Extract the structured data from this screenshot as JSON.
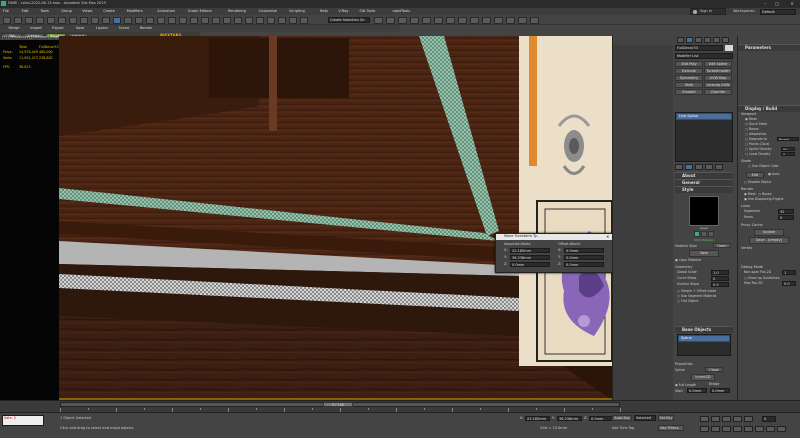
{
  "titlebar": {
    "title": "FAME - coins-2022-06-13.max - Autodesk 3ds Max 2019",
    "signin": "Sign In",
    "workspaces": "Workspaces:",
    "workspace_value": "Default"
  },
  "menu": [
    "File",
    "Edit",
    "Tools",
    "Group",
    "Views",
    "Create",
    "Modifiers",
    "Animation",
    "Graph Editors",
    "Rendering",
    "Customize",
    "Scripting",
    "Help",
    "V-Ray",
    "Silk Tools",
    "rapidTools"
  ],
  "toolbar": {
    "selection_set": "Create Selection Se",
    "row2": [
      "Merge",
      "Import",
      "Export",
      "Save",
      "Layers",
      "Scene",
      "Render"
    ]
  },
  "row3": {
    "tabs": [
      "Tab",
      "Layers",
      "Render",
      "Layout"
    ],
    "logo": "MAXTABS"
  },
  "viewport": {
    "label": "[+] [Perspective] [Standard] [Edged Faces]",
    "stats": {
      "col1": "Total",
      "col2": "FullDecor33",
      "rows": [
        [
          "Polys:",
          "14,978,449",
          "480,000"
        ],
        [
          "Verts:",
          "11,901,473",
          "238,802"
        ],
        [
          "FPS:",
          "38.023",
          ""
        ]
      ]
    }
  },
  "dialog": {
    "title": "Move Transform Ty...",
    "absolute_label": "Absolute:World",
    "offset_label": "Offset:World",
    "abs": [
      [
        "X:",
        "22.185mm"
      ],
      [
        "Y:",
        "36.238mm"
      ],
      [
        "Z:",
        "0.0mm"
      ]
    ],
    "off": [
      [
        "X:",
        "0.0mm"
      ],
      [
        "Y:",
        "0.0mm"
      ],
      [
        "Z:",
        "0.0mm"
      ]
    ]
  },
  "middle_panel": {
    "object_name": "FullDecor33",
    "modifier_list": "Modifier List",
    "buttons": [
      [
        "Edit Poly",
        "Edit Spline"
      ],
      [
        "Extrude",
        "TurboSmooth"
      ],
      [
        "Symmetry",
        "UVW Map"
      ],
      [
        "Shell",
        "Unwrap UVW"
      ],
      [
        "Smooth",
        "Chamfer"
      ]
    ],
    "stack_item": "Line Spline",
    "about": "About",
    "general": "General",
    "style": "Style",
    "check": "2D Check",
    "swatch": "Layer",
    "material": "Pick Material",
    "mat_btns": [
      "Open",
      "New"
    ],
    "mat_label": "Material Style",
    "copy_mat": "Copy Material",
    "geometry": "Geometry",
    "global": "Global Scale",
    "curve": "Curve Steps",
    "surface": "Surface Steps",
    "geo_vals": [
      "1.0",
      "0",
      "0.0"
    ],
    "checks": [
      "Simple + Offset mode",
      "Use Segment Material",
      "Flat Object"
    ],
    "base_objects": "Base Objects",
    "base_item": "Spline",
    "properties": "Properties",
    "prop_spline": "Spline",
    "prop_close": "Close",
    "prop_val": "Invert2D",
    "fulllength": "Full Length",
    "bridge": "Bridge",
    "start": "Start",
    "start_vals": [
      "0.0mm",
      "0.0mm"
    ]
  },
  "right_panel": {
    "title": "Parameters",
    "display": "Display / Build",
    "viewport": "Viewport",
    "opts": [
      "Mesh",
      "Quick Mesh",
      "Boxes",
      "Adaptative",
      "Degrade to",
      "Points Cloud",
      "Sprite Density",
      "Local Density"
    ],
    "degrade_val": "Boxes",
    "sprite_val": "50",
    "local_val": "0",
    "shade": "Shade",
    "use_color": "Use Object Color",
    "edit": "Edit",
    "auto": "Auto",
    "disable": "Disable Object",
    "render": "Render",
    "mesh": "Mesh",
    "boxes": "Boxes",
    "use_displace": "Use Displacing Engine",
    "lines": "Lines",
    "segments": "Segments",
    "faces": "Faces",
    "seg_val": "32",
    "faces_val": "0",
    "proxy": "Proxy Cache",
    "proxy_vals": [
      "Update",
      "Save - (empty)"
    ],
    "vertex": "Vertex",
    "debug": "Debug Mode",
    "nonspan": "Non-span Pos.2D",
    "show_up": "Show up Guidelines",
    "max_pos": "Max Pos.3D",
    "debug_vals": [
      "1",
      "0.0"
    ]
  },
  "bottom": {
    "timeline": "0 / 100",
    "status1": "1 Object Selected",
    "status2": "Click and drag to select and move objects",
    "cmd": "Sale: 2",
    "coords": [
      [
        "X:",
        "22.185mm"
      ],
      [
        "Y:",
        "36.238mm"
      ],
      [
        "Z:",
        "0.0mm"
      ]
    ],
    "grid": "Grid = 10.0mm",
    "autokey": "Auto Key",
    "selected": "Selected",
    "addtime": "Add Time Tag",
    "setkey": "Set Key",
    "keyfilters": "Key Filters...",
    "frame": "0"
  },
  "colors": {
    "accent": "#4a6f9f",
    "active_yellow": "#e0a800",
    "bg": "#444444"
  }
}
